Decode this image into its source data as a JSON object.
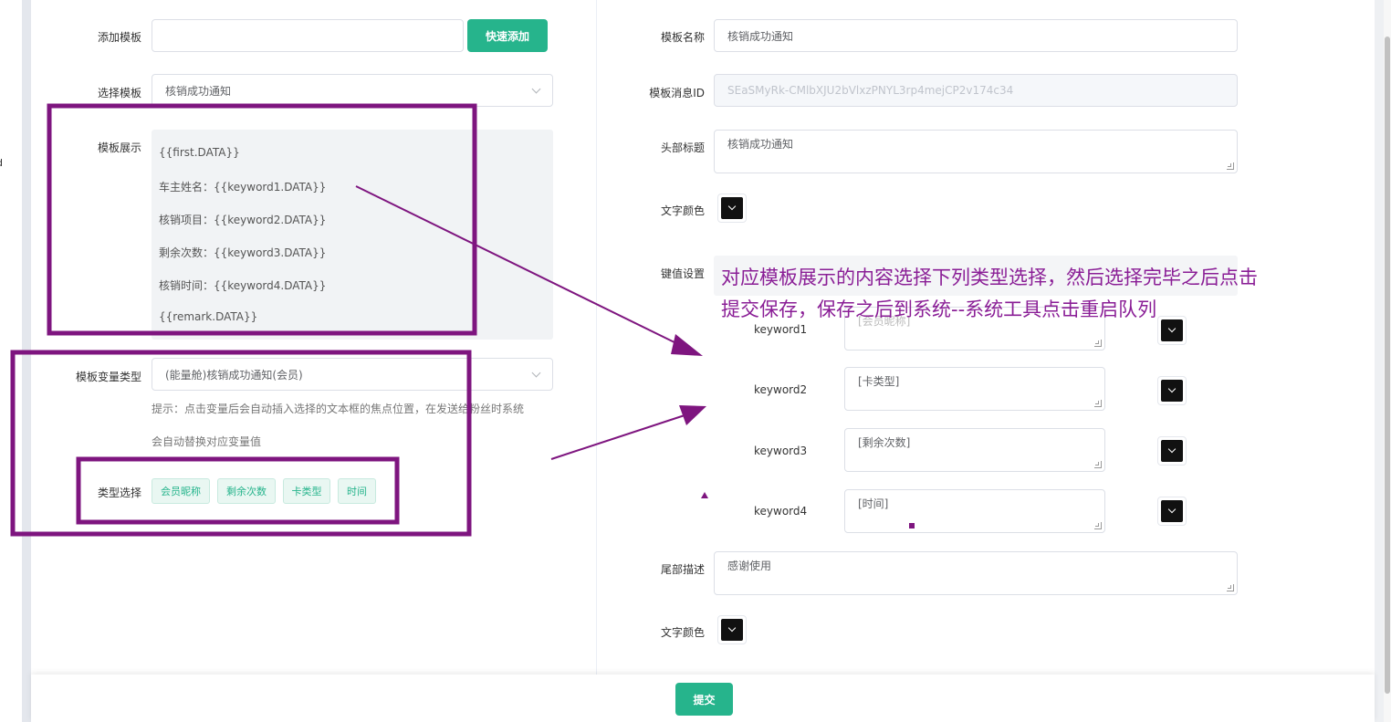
{
  "sidebar_stub_text": "d",
  "left_form": {
    "add_template_label": "添加模板",
    "add_template_value": "",
    "quick_add_button": "快速添加",
    "select_template_label": "选择模板",
    "select_template_value": "核销成功通知",
    "template_display_label": "模板展示",
    "template_display_lines": [
      "{{first.DATA}}",
      "车主姓名：{{keyword1.DATA}}",
      "核销项目：{{keyword2.DATA}}",
      "剩余次数：{{keyword3.DATA}}",
      "核销时间：{{keyword4.DATA}}",
      "{{remark.DATA}}"
    ],
    "var_type_label": "模板变量类型",
    "var_type_value": "(能量舱)核销成功通知(会员)",
    "hint_line1": "提示：点击变量后会自动插入选择的文本框的焦点位置，在发送给粉丝时系统",
    "hint_line2": "会自动替换对应变量值",
    "type_select_label": "类型选择",
    "type_tags": [
      "会员昵称",
      "剩余次数",
      "卡类型",
      "时间"
    ]
  },
  "right_form": {
    "template_name_label": "模板名称",
    "template_name_value": "核销成功通知",
    "template_id_label": "模板消息ID",
    "template_id_value": "SEaSMyRk-CMlbXJU2bVlxzPNYL3rp4mejCP2v174c34",
    "header_title_label": "头部标题",
    "header_title_value": "核销成功通知",
    "text_color_label": "文字颜色",
    "kv_settings_label": "键值设置",
    "keywords": [
      {
        "key": "keyword1",
        "value": "[会员昵称]"
      },
      {
        "key": "keyword2",
        "value": "[卡类型]"
      },
      {
        "key": "keyword3",
        "value": "[剩余次数]"
      },
      {
        "key": "keyword4",
        "value": "[时间]"
      }
    ],
    "footer_desc_label": "尾部描述",
    "footer_desc_value": "感谢使用",
    "footer_color_label": "文字颜色"
  },
  "submit_button": "提交",
  "annotation": {
    "line1": "对应模板展示的内容选择下列类型选择，然后选择完毕之后点击",
    "line2": "提交保存，保存之后到系统--系统工具点击重启队列"
  },
  "colors": {
    "accent": "#26b48c",
    "annotation": "#8a1e96",
    "swatch": "#111111"
  }
}
